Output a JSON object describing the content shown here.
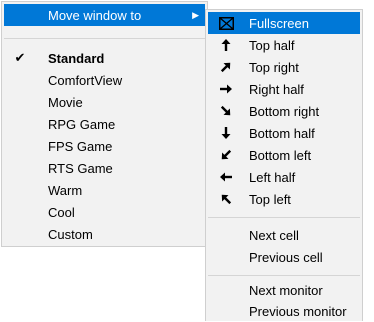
{
  "main_menu": {
    "move_window_to": "Move window to",
    "items": [
      "Standard",
      "ComfortView",
      "Movie",
      "RPG Game",
      "FPS Game",
      "RTS Game",
      "Warm",
      "Cool",
      "Custom"
    ],
    "checked": "Standard"
  },
  "sub_menu": {
    "positions": [
      "Fullscreen",
      "Top half",
      "Top right",
      "Right half",
      "Bottom right",
      "Bottom half",
      "Bottom left",
      "Left half",
      "Top left"
    ],
    "cells": [
      "Next cell",
      "Previous cell"
    ],
    "monitors": [
      "Next monitor",
      "Previous monitor"
    ]
  },
  "colors": {
    "highlight": "#0078d7",
    "menu_bg": "#f2f2f2",
    "separator": "#d5d5d5"
  },
  "icons": [
    "fullscreen-icon",
    "arrow-up-icon",
    "arrow-up-right-icon",
    "arrow-right-icon",
    "arrow-down-right-icon",
    "arrow-down-icon",
    "arrow-down-left-icon",
    "arrow-left-icon",
    "arrow-up-left-icon"
  ]
}
